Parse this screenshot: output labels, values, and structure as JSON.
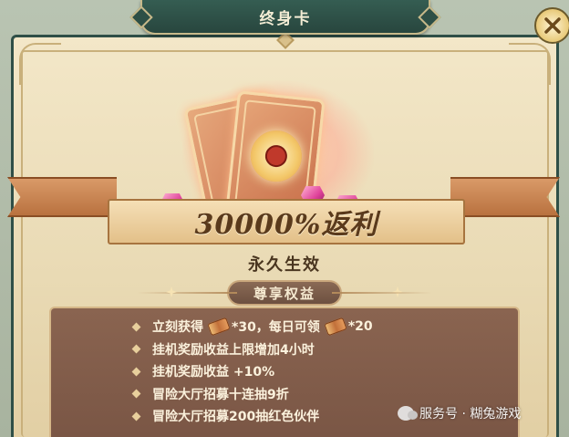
{
  "title": "终身卡",
  "close_icon": "close-icon",
  "banner": {
    "rebate_text": "30000%返利"
  },
  "effect_text": "永久生效",
  "benefits": {
    "header": "尊享权益",
    "items": [
      {
        "prefix": "立刻获得",
        "amount_1": "*30，每日可领",
        "amount_2": "*20"
      },
      {
        "text": "挂机奖励收益上限增加4小时"
      },
      {
        "text": "挂机奖励收益 +10%"
      },
      {
        "text": "冒险大厅招募十连抽9折"
      },
      {
        "text": "冒险大厅招募200抽红色伙伴"
      }
    ]
  },
  "watermark": {
    "text": "服务号 · 糊兔游戏"
  },
  "colors": {
    "title_bar": "#2d4f46",
    "panel": "#eee0bc",
    "list_box": "#7f5a48",
    "gem": "#e0439b"
  }
}
